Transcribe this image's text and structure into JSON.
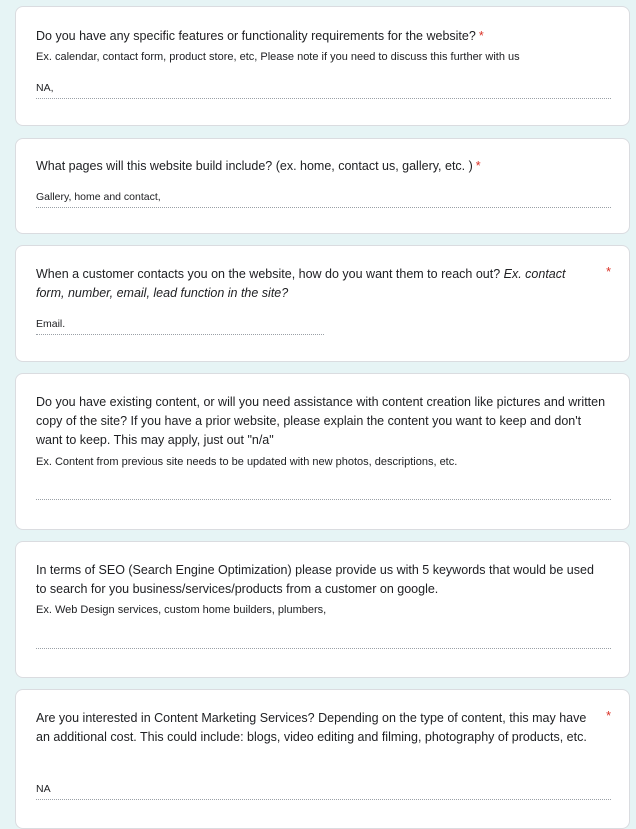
{
  "questions": [
    {
      "text": "Do you have any specific features or functionality requirements for the website?",
      "required": "*",
      "hint": "Ex. calendar, contact form, product store, etc, Please note if you need to discuss this further with us",
      "answer": "NA,"
    },
    {
      "text": "What pages will this website build include? (ex. home, contact us, gallery, etc. )",
      "required": "*",
      "answer": "Gallery, home and contact,"
    },
    {
      "text": "When a customer contacts you on the website, how do you want them to reach out?",
      "italic_hint": "Ex. contact form, number, email, lead function in the site?",
      "required": "*",
      "answer": "Email."
    },
    {
      "text": "Do you have existing content, or will you need assistance with content creation like pictures and written copy of the site? If you have a prior website, please explain the content you want to keep and don't want to keep. This may apply, just out \"n/a\"",
      "hint": "Ex. Content from previous site needs to be updated with new photos, descriptions, etc.",
      "answer": ""
    },
    {
      "text": "In terms of SEO (Search Engine Optimization) please provide us with 5 keywords that would be used to search for you business/services/products from a customer on google.",
      "hint": "Ex. Web Design services, custom home builders, plumbers,",
      "answer": ""
    },
    {
      "text": "Are you interested in Content Marketing Services? Depending on the type of content, this may have an additional cost. This could include: blogs, video editing and filming, photography of products, etc.",
      "required": "*",
      "answer": "NA"
    }
  ],
  "colors": {
    "background": "#e6f4f5",
    "card": "#ffffff",
    "required": "#d93025"
  }
}
